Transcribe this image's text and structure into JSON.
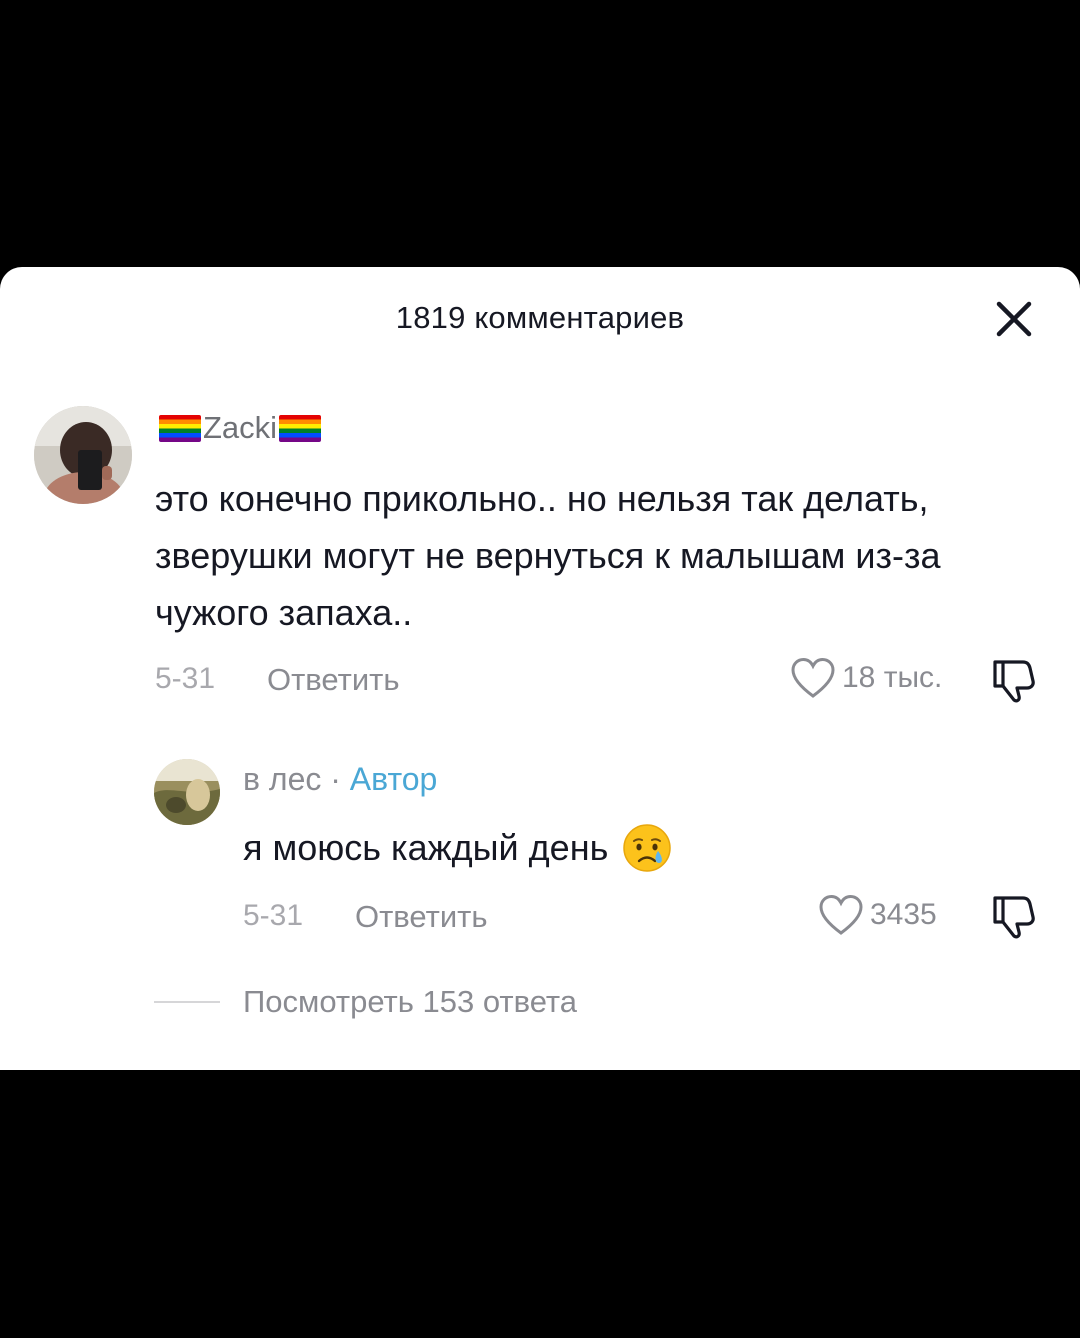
{
  "header": {
    "title": "1819 комментариев",
    "close_icon": "close-icon"
  },
  "comment": {
    "username": "Zacki",
    "text": "это конечно прикольно.. но нельзя так делать, зверушки могут не вернуться к малышам из-за чужого запаха..",
    "date": "5-31",
    "reply_label": "Ответить",
    "likes": "18 тыс."
  },
  "reply": {
    "username": "в лес",
    "separator": "·",
    "author_tag": "Автор",
    "text": "я моюсь каждый день",
    "emoji": "crying-face-icon",
    "date": "5-31",
    "reply_label": "Ответить",
    "likes": "3435"
  },
  "view_replies": "Посмотреть 153 ответа",
  "colors": {
    "author_accent": "#4aa7d5",
    "muted": "#8a8b91",
    "text": "#161823"
  }
}
